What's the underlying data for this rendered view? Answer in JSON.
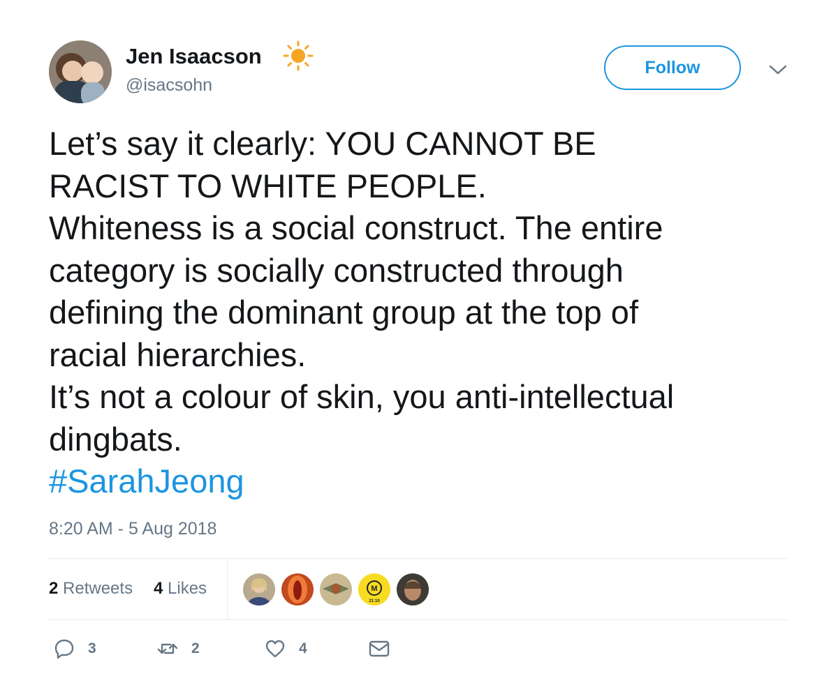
{
  "author": {
    "display_name": "Jen Isaacson",
    "handle": "@isacsohn",
    "name_emoji": "sun-icon"
  },
  "follow_button": {
    "label": "Follow"
  },
  "tweet": {
    "lines": [
      "Let’s say it clearly: YOU CANNOT BE",
      "RACIST TO WHITE PEOPLE.",
      "Whiteness is a social construct. The entire",
      "category is socially constructed through",
      "defining the dominant group at the top of",
      "racial hierarchies.",
      "It’s not a colour of skin, you anti-intellectual",
      "dingbats."
    ],
    "hashtag": "#SarahJeong",
    "timestamp": "8:20 AM - 5 Aug 2018"
  },
  "stats": {
    "retweets_count": "2",
    "retweets_label": "Retweets",
    "likes_count": "4",
    "likes_label": "Likes"
  },
  "liker_avatar_text": "21:10",
  "actions": {
    "reply_count": "3",
    "retweet_count": "2",
    "like_count": "4"
  },
  "colors": {
    "link_blue": "#1b95e0",
    "text_primary": "#14171a",
    "text_secondary": "#657786",
    "sun_orange": "#f5a623"
  }
}
